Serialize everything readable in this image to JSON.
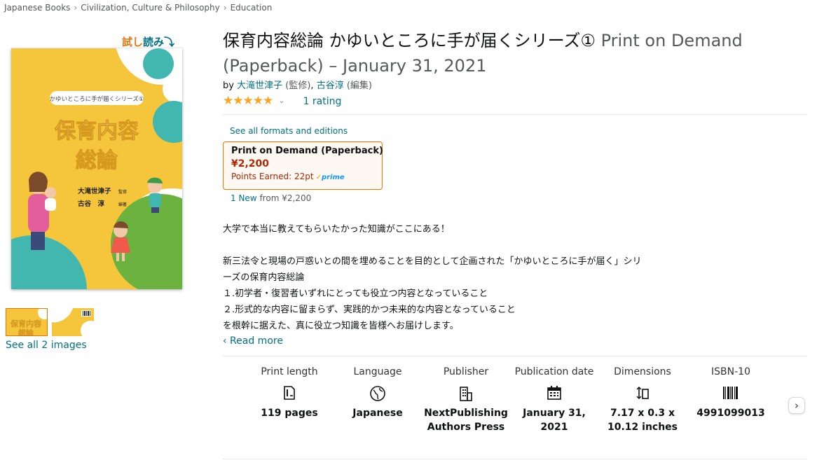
{
  "breadcrumb": [
    {
      "label": "Japanese Books"
    },
    {
      "label": "Civilization, Culture & Philosophy"
    },
    {
      "label": "Education"
    }
  ],
  "breadcrumb_separator": "›",
  "look_inside": {
    "part1": "試し",
    "part2": "読み",
    "arrow": "⤵"
  },
  "cover": {
    "series_banner": "かゆいところに手が届くシリーズ①",
    "title_line1": "保育内容",
    "title_line2": "総論",
    "editor1": "大滝世津子",
    "editor1_role": "監修",
    "editor2": "古谷　淳",
    "editor2_role": "編著"
  },
  "images": {
    "see_all": "See all 2 images",
    "thumb1_text": "保育内容",
    "thumb1_text2": "総論"
  },
  "product": {
    "title": "保育内容総論 かゆいところに手が届くシリーズ①",
    "format_date": "Print on Demand (Paperback) – January 31, 2021",
    "by": "by",
    "authors": [
      {
        "name": "大滝世津子",
        "role": "(監修)",
        "sep": ","
      },
      {
        "name": "古谷淳",
        "role": "(編集)",
        "sep": ""
      }
    ],
    "stars": "★★★★★",
    "chevron": "⌄",
    "rating_count": "1 rating",
    "rating_value": 5
  },
  "formats": {
    "see_all": "See all formats and editions",
    "selected": {
      "name": "Print on Demand (Paperback)",
      "price": "¥2,200",
      "points": "Points Earned: 22pt",
      "prime_check": "✓",
      "prime": "prime"
    },
    "new_count": "1 New",
    "new_from": "from",
    "new_price": "¥2,200"
  },
  "description": {
    "p1": "大学で本当に教えてもらいたかった知識がここにある！",
    "p2": "新三法令と現場の戸惑いとの間を埋めることを目的として企画された「かゆいところに手が届く」シリ",
    "p3": "ーズの保育内容総論",
    "p4": "１.初学者・復習者いずれにとっても役立つ内容となっていること",
    "p5": "２.形式的な内容に留まらず、実践的かつ未来的な内容となっていること",
    "p6": "を根幹に据えた、真に役立つ知識を皆様へお届けします。",
    "read_more": "‹ Read more"
  },
  "details": [
    {
      "label": "Print length",
      "icon": "page-count-icon",
      "value": "119 pages"
    },
    {
      "label": "Language",
      "icon": "globe-icon",
      "value": "Japanese"
    },
    {
      "label": "Publisher",
      "icon": "building-icon",
      "value": "NextPublishing Authors Press"
    },
    {
      "label": "Publication date",
      "icon": "calendar-icon",
      "value": "January 31, 2021"
    },
    {
      "label": "Dimensions",
      "icon": "dimensions-icon",
      "value": "7.17 x 0.3 x 10.12 inches"
    },
    {
      "label": "ISBN-10",
      "icon": "barcode-icon",
      "value": "4991099013"
    }
  ],
  "next_button": "›",
  "colors": {
    "link": "#007185",
    "price": "#b12704",
    "star": "#ffa41c",
    "selected_border": "#e77600",
    "cover_yellow": "#f5c53c",
    "look_inside_orange": "#e47911"
  }
}
